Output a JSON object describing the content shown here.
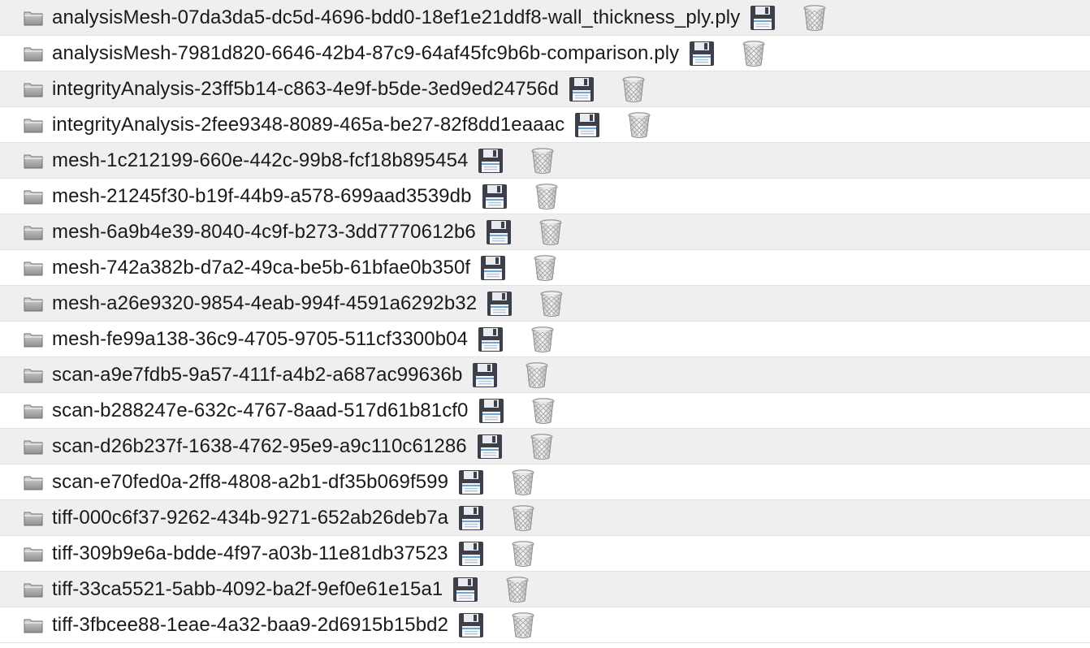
{
  "icons": {
    "folder": "folder-icon",
    "save": "floppy-disk-icon",
    "delete": "trash-can-icon"
  },
  "files": [
    "analysisMesh-07da3da5-dc5d-4696-bdd0-18ef1e21ddf8-wall_thickness_ply.ply",
    "analysisMesh-7981d820-6646-42b4-87c9-64af45fc9b6b-comparison.ply",
    "integrityAnalysis-23ff5b14-c863-4e9f-b5de-3ed9ed24756d",
    "integrityAnalysis-2fee9348-8089-465a-be27-82f8dd1eaaac",
    "mesh-1c212199-660e-442c-99b8-fcf18b895454",
    "mesh-21245f30-b19f-44b9-a578-699aad3539db",
    "mesh-6a9b4e39-8040-4c9f-b273-3dd7770612b6",
    "mesh-742a382b-d7a2-49ca-be5b-61bfae0b350f",
    "mesh-a26e9320-9854-4eab-994f-4591a6292b32",
    "mesh-fe99a138-36c9-4705-9705-511cf3300b04",
    "scan-a9e7fdb5-9a57-411f-a4b2-a687ac99636b",
    "scan-b288247e-632c-4767-8aad-517d61b81cf0",
    "scan-d26b237f-1638-4762-95e9-a9c110c61286",
    "scan-e70fed0a-2ff8-4808-a2b1-df35b069f599",
    "tiff-000c6f37-9262-434b-9271-652ab26deb7a",
    "tiff-309b9e6a-bdde-4f97-a03b-11e81db37523",
    "tiff-33ca5521-5abb-4092-ba2f-9ef0e61e15a1",
    "tiff-3fbcee88-1eae-4a32-baa9-2d6915b15bd2"
  ]
}
